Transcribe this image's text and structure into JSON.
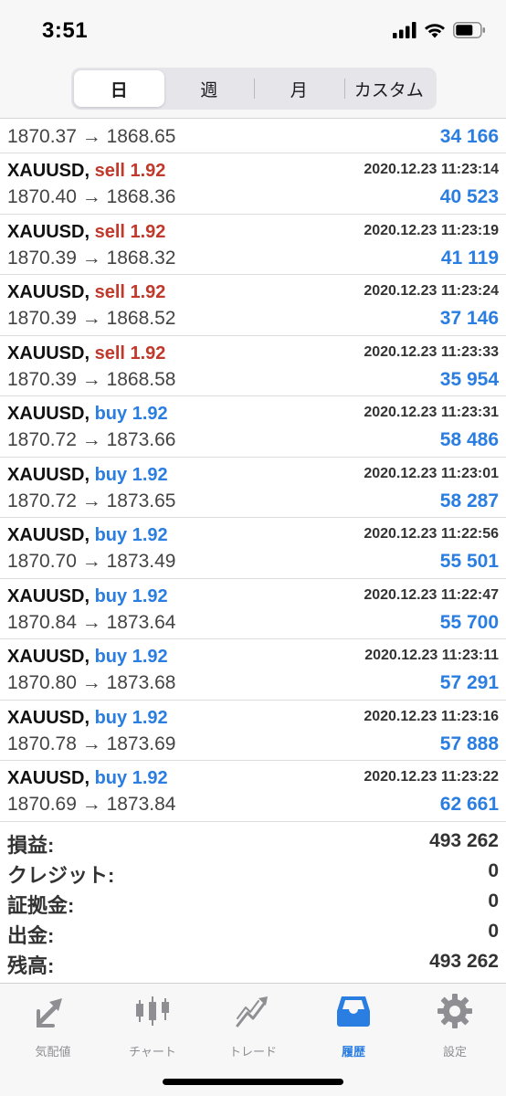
{
  "status_bar": {
    "time": "3:51"
  },
  "segments": [
    {
      "label": "日",
      "active": true
    },
    {
      "label": "週",
      "active": false
    },
    {
      "label": "月",
      "active": false
    },
    {
      "label": "カスタム",
      "active": false
    }
  ],
  "first_row": {
    "prices": "1870.37 → 1868.65",
    "profit": "34 166"
  },
  "deals": [
    {
      "symbol": "XAUUSD,",
      "side": "sell 1.92",
      "type": "sell",
      "time": "2020.12.23 11:23:14",
      "prices": "1870.40 → 1868.36",
      "profit": "40 523"
    },
    {
      "symbol": "XAUUSD,",
      "side": "sell 1.92",
      "type": "sell",
      "time": "2020.12.23 11:23:19",
      "prices": "1870.39 → 1868.32",
      "profit": "41 119"
    },
    {
      "symbol": "XAUUSD,",
      "side": "sell 1.92",
      "type": "sell",
      "time": "2020.12.23 11:23:24",
      "prices": "1870.39 → 1868.52",
      "profit": "37 146"
    },
    {
      "symbol": "XAUUSD,",
      "side": "sell 1.92",
      "type": "sell",
      "time": "2020.12.23 11:23:33",
      "prices": "1870.39 → 1868.58",
      "profit": "35 954"
    },
    {
      "symbol": "XAUUSD,",
      "side": "buy 1.92",
      "type": "buy",
      "time": "2020.12.23 11:23:31",
      "prices": "1870.72 → 1873.66",
      "profit": "58 486"
    },
    {
      "symbol": "XAUUSD,",
      "side": "buy 1.92",
      "type": "buy",
      "time": "2020.12.23 11:23:01",
      "prices": "1870.72 → 1873.65",
      "profit": "58 287"
    },
    {
      "symbol": "XAUUSD,",
      "side": "buy 1.92",
      "type": "buy",
      "time": "2020.12.23 11:22:56",
      "prices": "1870.70 → 1873.49",
      "profit": "55 501"
    },
    {
      "symbol": "XAUUSD,",
      "side": "buy 1.92",
      "type": "buy",
      "time": "2020.12.23 11:22:47",
      "prices": "1870.84 → 1873.64",
      "profit": "55 700"
    },
    {
      "symbol": "XAUUSD,",
      "side": "buy 1.92",
      "type": "buy",
      "time": "2020.12.23 11:23:11",
      "prices": "1870.80 → 1873.68",
      "profit": "57 291"
    },
    {
      "symbol": "XAUUSD,",
      "side": "buy 1.92",
      "type": "buy",
      "time": "2020.12.23 11:23:16",
      "prices": "1870.78 → 1873.69",
      "profit": "57 888"
    },
    {
      "symbol": "XAUUSD,",
      "side": "buy 1.92",
      "type": "buy",
      "time": "2020.12.23 11:23:22",
      "prices": "1870.69 → 1873.84",
      "profit": "62 661"
    }
  ],
  "summary": [
    {
      "label": "損益:",
      "value": "493 262"
    },
    {
      "label": "クレジット:",
      "value": "0"
    },
    {
      "label": "証拠金:",
      "value": "0"
    },
    {
      "label": "出金:",
      "value": "0"
    },
    {
      "label": "残高:",
      "value": "493 262"
    }
  ],
  "tabbar": [
    {
      "label": "気配値",
      "icon": "quotes-arrows-icon",
      "active": false
    },
    {
      "label": "チャート",
      "icon": "candlestick-chart-icon",
      "active": false
    },
    {
      "label": "トレード",
      "icon": "trade-line-icon",
      "active": false
    },
    {
      "label": "履歴",
      "icon": "history-tray-icon",
      "active": true
    },
    {
      "label": "設定",
      "icon": "gear-icon",
      "active": false
    }
  ],
  "colors": {
    "accent": "#2a7de1",
    "sell": "#c0392b",
    "buy": "#2a7de1",
    "inactive_icon": "#8e8e93"
  }
}
